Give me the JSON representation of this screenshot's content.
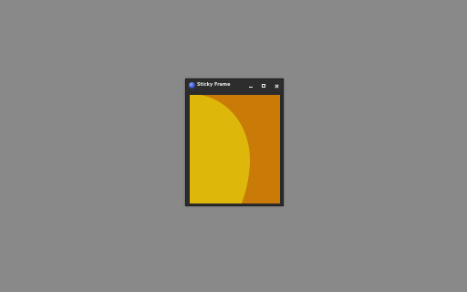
{
  "window": {
    "title": "Sticky Frame",
    "app_icon": "app-logo-icon",
    "controls": {
      "minimize": "minimize-icon",
      "maximize": "maximize-icon",
      "close": "close-icon"
    }
  },
  "content": {
    "background_color": "#c97a07",
    "shape_color": "#ddb80b"
  },
  "desktop": {
    "background_color": "#898989"
  }
}
